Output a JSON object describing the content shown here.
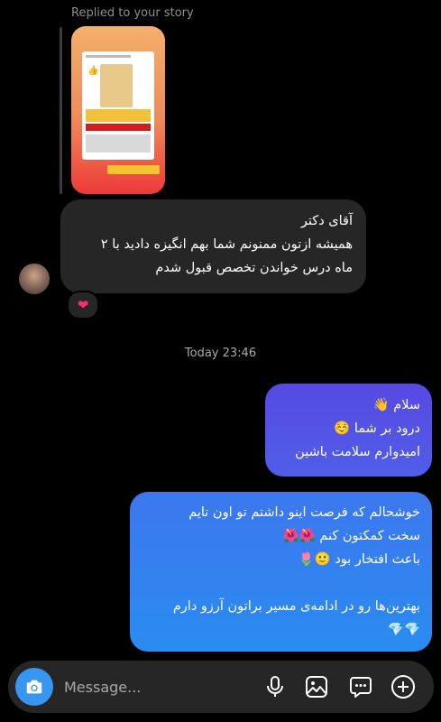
{
  "thread": {
    "replied_label": "Replied to your story",
    "incoming_message": {
      "lines": [
        "آقای دکتر",
        "همیشه ازتون ممنونم شما بهم انگیزه دادید با ۲",
        "ماه درس خواندن تخصص قبول شدم"
      ],
      "reaction": "❤"
    },
    "timestamp": "Today 23:46",
    "outgoing_messages": [
      {
        "lines": [
          "سلام 👋",
          "درود بر شما ☺️",
          "امیدوارم سلامت باشین"
        ]
      },
      {
        "lines": [
          "خوشحالم که فرصت اینو داشتم تو اون تایم",
          "سخت کمکتون کنم 🌺🌺",
          "باعث افتخار بود 🙂🌷",
          "",
          "بهترین‌ها رو در ادامه‌ی مسیر براتون آرزو دارم",
          "💎💎"
        ]
      }
    ]
  },
  "composer": {
    "placeholder": "Message...",
    "icons": [
      "camera-icon",
      "microphone-icon",
      "gallery-icon",
      "sticker-icon",
      "add-icon"
    ],
    "accent_color": "#3797f0"
  },
  "colors": {
    "background": "#000000",
    "incoming_bubble": "#262626",
    "outgoing_top": "#5749e2",
    "outgoing_bottom": "#2a8cf2"
  }
}
